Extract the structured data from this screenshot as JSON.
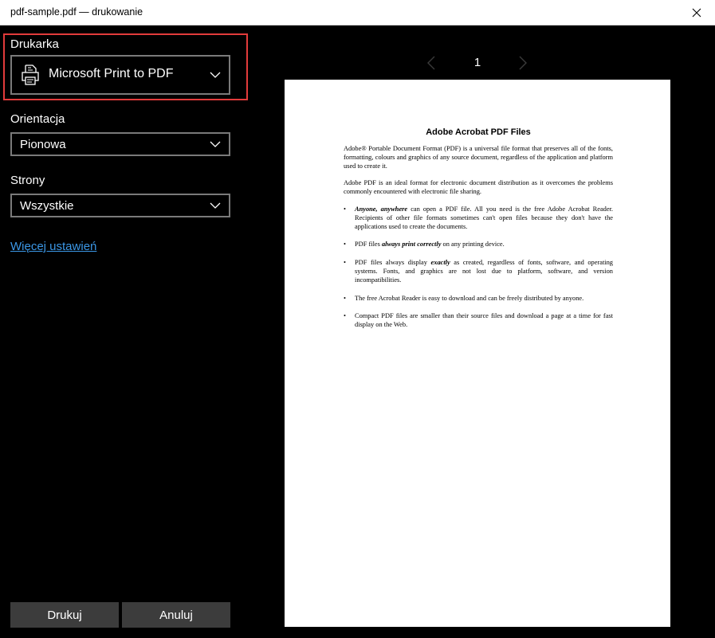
{
  "window": {
    "title": "pdf-sample.pdf — drukowanie"
  },
  "settings": {
    "printer_label": "Drukarka",
    "printer_value": "Microsoft Print to PDF",
    "orientation_label": "Orientacja",
    "orientation_value": "Pionowa",
    "pages_label": "Strony",
    "pages_value": "Wszystkie",
    "more_settings": "Więcej ustawień",
    "print_button": "Drukuj",
    "cancel_button": "Anuluj"
  },
  "preview": {
    "page_number": "1",
    "doc": {
      "title": "Adobe Acrobat PDF Files",
      "p1": "Adobe® Portable Document Format (PDF) is a universal file format that preserves all of the fonts, formatting, colours and graphics of any source document, regardless of the application and platform used to create it.",
      "p2": "Adobe PDF is an ideal format for electronic document distribution as it overcomes the problems commonly encountered with electronic file sharing.",
      "b1_em": "Anyone, anywhere",
      "b1_rest": " can open a PDF file. All you need is the free Adobe Acrobat Reader. Recipients of other file formats sometimes can't open files because they don't have the applications used to create the documents.",
      "b2_pre": "PDF files ",
      "b2_em": "always print correctly",
      "b2_post": " on any printing device.",
      "b3_pre": "PDF files always display ",
      "b3_em": "exactly",
      "b3_post": " as created, regardless of fonts, software, and operating systems. Fonts, and graphics are not lost due to platform, software, and version incompatibilities.",
      "b4": "The free Acrobat Reader is easy to download and can be freely distributed by anyone.",
      "b5": "Compact PDF files are smaller than their source files and download a page at a time for fast display on the Web.",
      "bullet": "•"
    }
  },
  "colors": {
    "highlight": "#e23b3b",
    "link": "#3b97e6",
    "button": "#3c3c3c"
  }
}
